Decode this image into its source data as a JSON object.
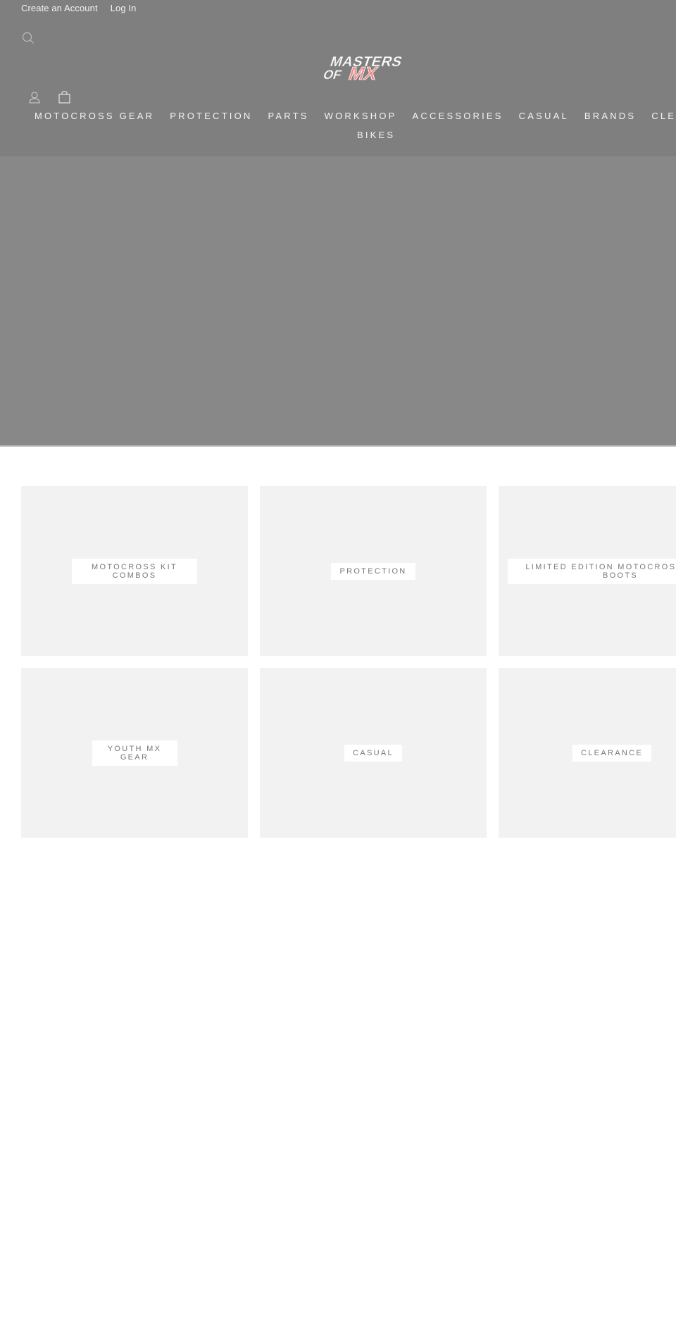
{
  "header": {
    "top_links": [
      {
        "label": "Create an Account"
      },
      {
        "label": "Log In"
      }
    ],
    "logo": {
      "line1": "MASTERS",
      "line2a": "OF",
      "line2b": "MX",
      "accent_color": "#f08a8a"
    },
    "icons": {
      "search": "search-icon",
      "account": "account-icon",
      "cart": "cart-icon"
    },
    "nav": [
      {
        "label": "Motocross Gear"
      },
      {
        "label": "Protection"
      },
      {
        "label": "Parts"
      },
      {
        "label": "Workshop"
      },
      {
        "label": "Accessories"
      },
      {
        "label": "Casual"
      },
      {
        "label": "Brands"
      },
      {
        "label": "Clearance"
      },
      {
        "label": "Bikes"
      }
    ]
  },
  "collections": [
    {
      "label": "Motocross Kit\nCombos"
    },
    {
      "label": "Protection"
    },
    {
      "label": "Limited Edition Motocross Gear\nBoots"
    },
    {
      "label": "Youth MX\nGear"
    },
    {
      "label": "Casual"
    },
    {
      "label": "Clearance"
    }
  ],
  "colors": {
    "header_bg": "#7f7f7f",
    "hero_bg": "#888888",
    "tile_bg": "#f2f2f2"
  }
}
